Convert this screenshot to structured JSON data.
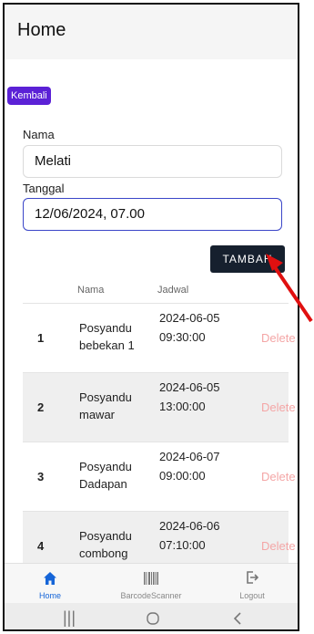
{
  "header": {
    "title": "Home"
  },
  "back_button": {
    "label": "Kembali"
  },
  "form": {
    "name_label": "Nama",
    "name_value": "Melati",
    "date_label": "Tanggal",
    "date_value": "12/06/2024, 07.00"
  },
  "add_button": {
    "label": "TAMBAH"
  },
  "table": {
    "headers": {
      "name": "Nama",
      "schedule": "Jadwal"
    },
    "rows": [
      {
        "index": "1",
        "name": "Posyandu bebekan 1",
        "schedule": "2024-06-05 09:30:00",
        "action": "Delete"
      },
      {
        "index": "2",
        "name": "Posyandu mawar",
        "schedule": "2024-06-05 13:00:00",
        "action": "Delete"
      },
      {
        "index": "3",
        "name": "Posyandu Dadapan",
        "schedule": "2024-06-07 09:00:00",
        "action": "Delete"
      },
      {
        "index": "4",
        "name": "Posyandu combong",
        "schedule": "2024-06-06 07:10:00",
        "action": "Delete"
      }
    ]
  },
  "bottom_nav": {
    "items": [
      {
        "label": "Home",
        "icon": "home-icon",
        "active": true
      },
      {
        "label": "BarcodeScanner",
        "icon": "barcode-icon",
        "active": false
      },
      {
        "label": "Logout",
        "icon": "logout-icon",
        "active": false
      }
    ]
  },
  "colors": {
    "accent": "#1565d8",
    "back_button": "#5b21d6",
    "add_button": "#16202e",
    "delete": "#f4a6a6",
    "arrow": "#e01010"
  }
}
